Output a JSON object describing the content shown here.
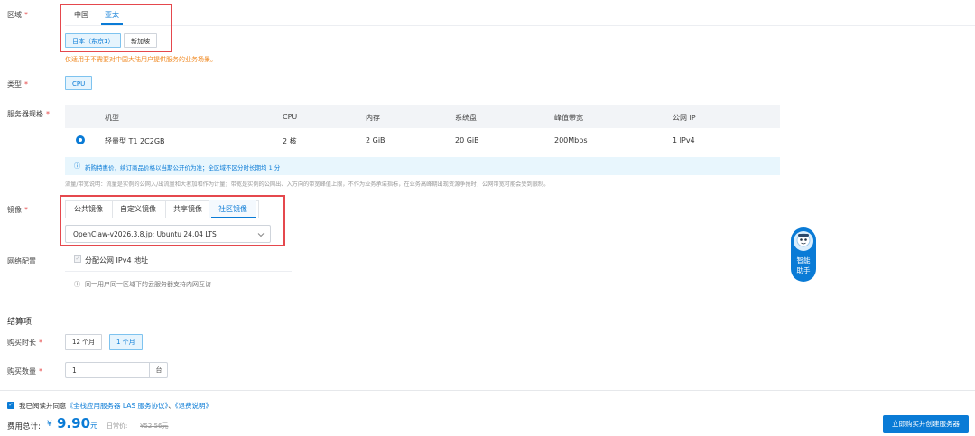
{
  "region": {
    "label": "区域",
    "tabs": [
      "中国",
      "亚太"
    ],
    "cities": [
      "日本（东京1）",
      "新加坡"
    ],
    "hint": "仅适用于不需要对中国大陆用户提供服务的业务场景。"
  },
  "type": {
    "label": "类型",
    "option": "CPU"
  },
  "spec": {
    "label": "服务器规格",
    "columns": [
      "机型",
      "CPU",
      "内存",
      "系统盘",
      "峰值带宽",
      "公网 IP"
    ],
    "row": [
      "轻量型 T1 2C2GB",
      "2 核",
      "2 GiB",
      "20 GiB",
      "200Mbps",
      "1 IPv4"
    ],
    "notice": "新购特惠价，续订商品价格以当期公开价为准；全区域不区分时长期均 1 分",
    "traffic_note": "流量/带宽说明：流量是实例的公网入/出流量和大者加和作为计量；带宽是实例的公网出、入方向的带宽峰值上限，不作为业务承诺指标，在业务高峰期出现资源争抢时，公网带宽可能会受到限制。"
  },
  "image": {
    "label": "镜像",
    "tabs": [
      "公共镜像",
      "自定义镜像",
      "共享镜像",
      "社区镜像"
    ],
    "selected": "OpenClaw-v2026.3.8.jp; Ubuntu 24.04 LTS"
  },
  "network": {
    "label": "网络配置",
    "checkbox": "分配公网 IPv4 地址",
    "note": "同一用户同一区域下的云服务器支持内网互访"
  },
  "billing": {
    "section_title": "结算项",
    "duration_label": "购买时长",
    "durations": [
      "12 个月",
      "1 个月"
    ],
    "quantity_label": "购买数量",
    "quantity": "1",
    "quantity_unit": "台"
  },
  "footer": {
    "agree_prefix": "我已阅读并同意",
    "agree_link1": "《全栈应用服务器 LAS 服务协议》",
    "agree_sep": "、",
    "agree_link2": "《退费说明》",
    "total_label": "费用总计:",
    "currency": "¥",
    "price": "9.90",
    "price_unit": "元",
    "original_label": "日常价:",
    "original_price": "¥52.56元",
    "buy_button": "立即购买并创建服务器"
  },
  "assistant": {
    "label1": "智能",
    "label2": "助手"
  },
  "colors": {
    "accent": "#0a7bd6",
    "required": "#e54545",
    "highlight_box": "#e5484d",
    "price": "#0a7bd6"
  }
}
